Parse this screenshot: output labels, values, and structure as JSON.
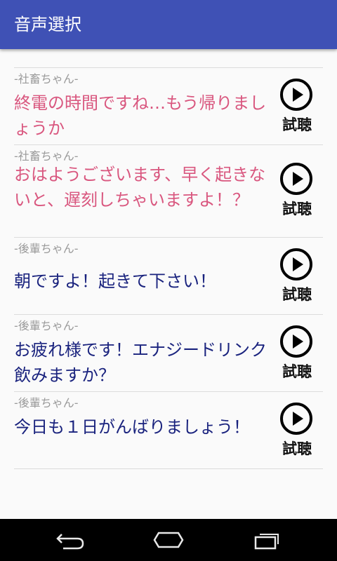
{
  "appbar": {
    "title": "音声選択"
  },
  "items": [
    {
      "speaker": "-社畜ちゃん-",
      "text": "終電の時間ですね…もう帰りましょうか",
      "play_label": "試聴",
      "text_color": "#d9577f"
    },
    {
      "speaker": "-社畜ちゃん-",
      "text": "おはようございます、早く起きないと、遅刻しちゃいますよ！？",
      "play_label": "試聴",
      "text_color": "#d9577f"
    },
    {
      "speaker": "-後輩ちゃん-",
      "text": "朝ですよ！起きて下さい！",
      "play_label": "試聴",
      "text_color": "#1a237e"
    },
    {
      "speaker": "-後輩ちゃん-",
      "text": "お疲れ様です！エナジードリンク飲みますか？",
      "play_label": "試聴",
      "text_color": "#1a237e"
    },
    {
      "speaker": "-後輩ちゃん-",
      "text": "今日も１日がんばりましょう！",
      "play_label": "試聴",
      "text_color": "#1a237e"
    }
  ],
  "navbar": {
    "icons": [
      "back-icon",
      "home-icon",
      "recent-apps-icon"
    ]
  },
  "colors": {
    "appbar": "#3f51b5",
    "shachiku": "#d9577f",
    "kouhai": "#1a237e"
  }
}
